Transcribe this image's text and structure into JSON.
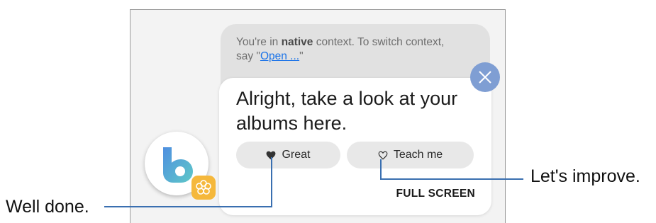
{
  "context": {
    "prefix": "You're in ",
    "context_name": "native",
    "middle": " context. To switch context,",
    "line2_prefix": "say \"",
    "link_text": "Open ...",
    "line2_suffix": "\""
  },
  "response": {
    "text": "Alright, take a look at your albums here."
  },
  "feedback": {
    "great_label": "Great",
    "great_icon": "heart-filled-icon",
    "teach_label": "Teach me",
    "teach_icon": "heart-outline-icon"
  },
  "full_screen_label": "FULL SCREEN",
  "close_icon": "close-icon",
  "assistant_icon": "bixby-logo-icon",
  "badge_icon": "flower-badge-icon",
  "callouts": {
    "left": "Well done.",
    "right": "Let's improve."
  },
  "colors": {
    "close_button": "#7f9ed3",
    "badge": "#f5b83c",
    "link": "#1a73e8",
    "logo_gradient": [
      "#4f8fe0",
      "#5ec8c8"
    ]
  }
}
